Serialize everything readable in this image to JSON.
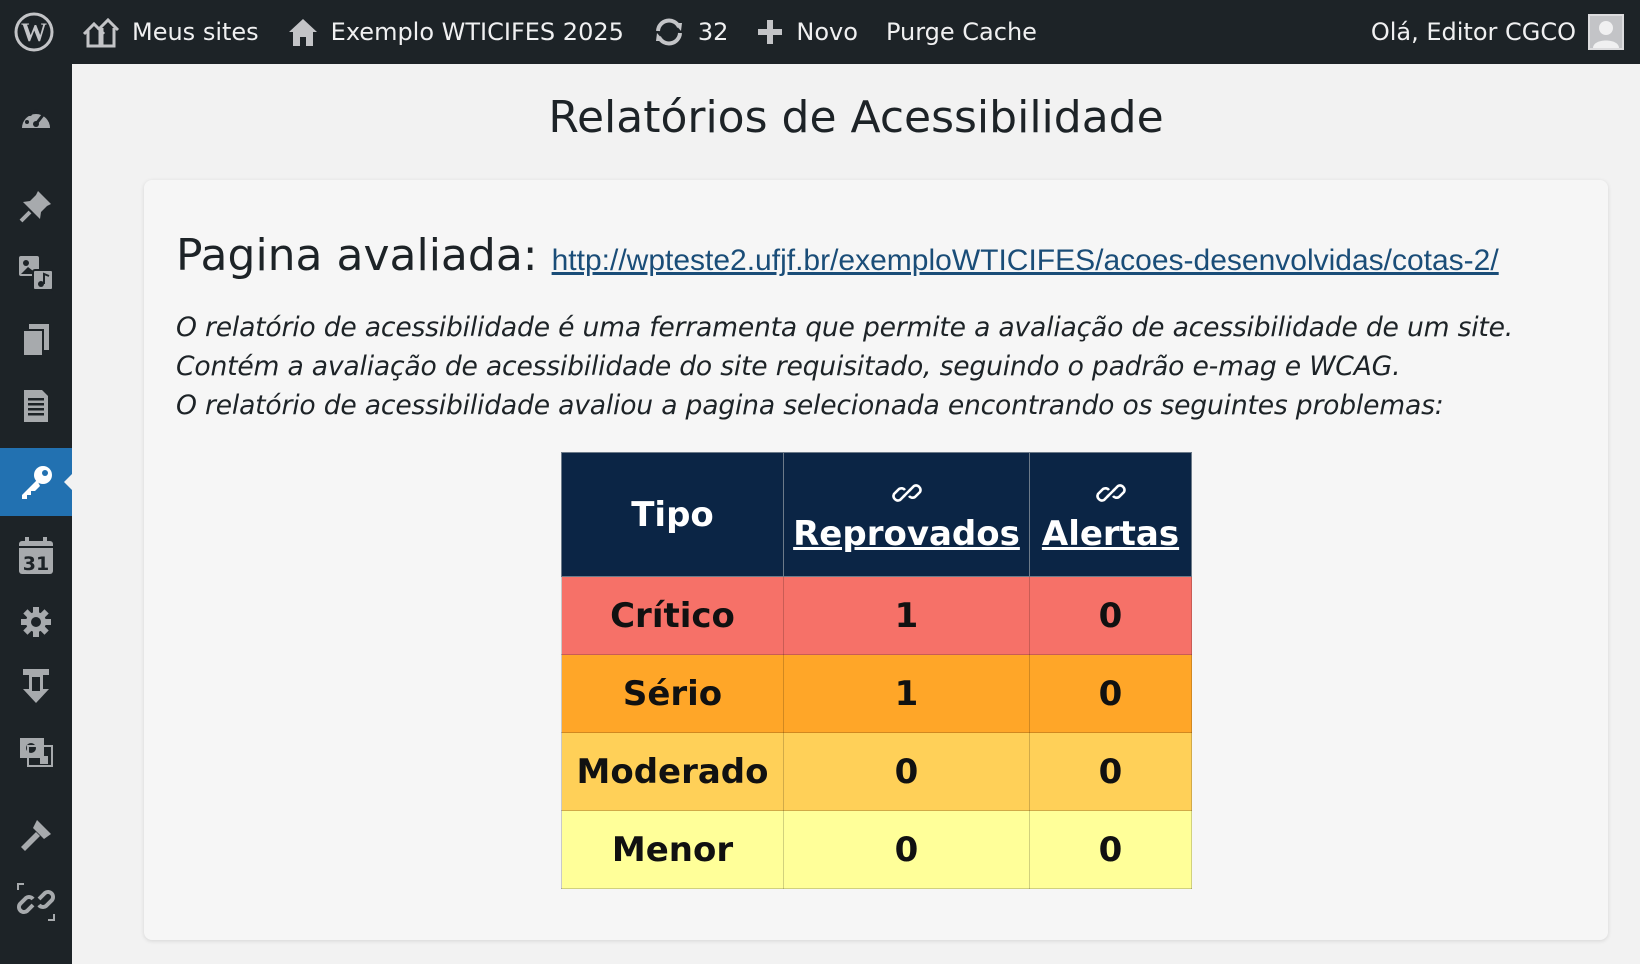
{
  "adminbar": {
    "my_sites": "Meus sites",
    "site_name": "Exemplo WTICIFES 2025",
    "updates_count": "32",
    "new_label": "Novo",
    "purge_cache": "Purge Cache",
    "greeting": "Olá, Editor CGCO"
  },
  "sidebar": {
    "icons": [
      "dashboard-icon",
      "pin-icon",
      "media-icon",
      "pages-icon",
      "forms-icon",
      "key-icon",
      "calendar-icon",
      "gear-icon",
      "download-icon",
      "gallery-icon",
      "tools-icon",
      "link-icon"
    ],
    "calendar_day": "31",
    "active_color": "#2271b1"
  },
  "page": {
    "title": "Relatórios de Acessibilidade",
    "evaluated_label": "Pagina avaliada:",
    "evaluated_url": "http://wpteste2.ufjf.br/exemploWTICIFES/acoes-desenvolvidas/cotas-2/",
    "description": [
      "O relatório de acessibilidade é uma ferramenta que permite a avaliação de acessibilidade de um site.",
      "Contém a avaliação de acessibilidade do site requisitado, seguindo o padrão e-mag e WCAG.",
      "O relatório de acessibilidade avaliou a pagina selecionada encontrando os seguintes problemas:"
    ]
  },
  "report_table": {
    "headers": {
      "type": "Tipo",
      "failed": "Reprovados",
      "alerts": "Alertas"
    },
    "rows": [
      {
        "type": "Crítico",
        "failed": "1",
        "alerts": "0",
        "color": "#f67168"
      },
      {
        "type": "Sério",
        "failed": "1",
        "alerts": "0",
        "color": "#ffa628"
      },
      {
        "type": "Moderado",
        "failed": "0",
        "alerts": "0",
        "color": "#ffd058"
      },
      {
        "type": "Menor",
        "failed": "0",
        "alerts": "0",
        "color": "#ffff99"
      }
    ]
  }
}
